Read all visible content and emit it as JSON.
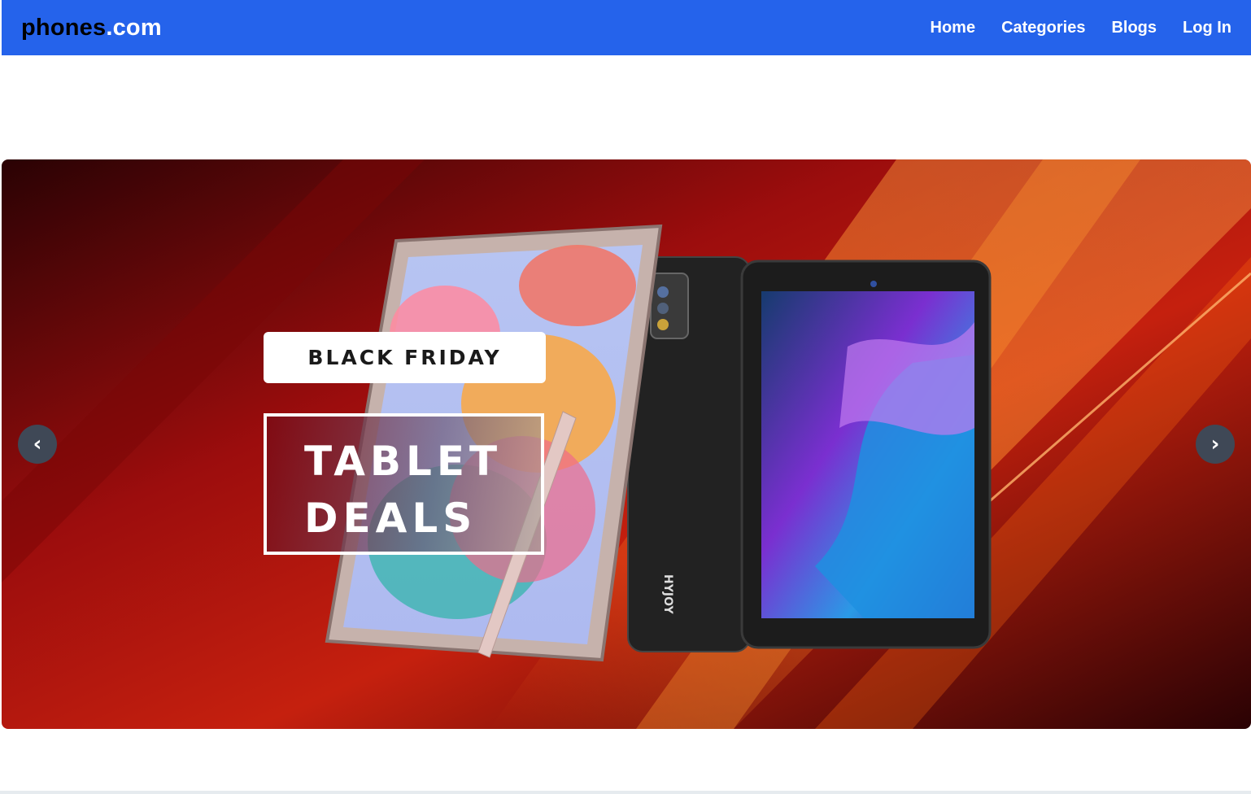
{
  "brand": {
    "name": "phones",
    "suffix": ".com"
  },
  "nav": {
    "links": [
      {
        "label": "Home"
      },
      {
        "label": "Categories"
      },
      {
        "label": "Blogs"
      },
      {
        "label": "Log In"
      }
    ]
  },
  "carousel": {
    "slide": {
      "badge_text": "BLACK FRIDAY",
      "headline_line1": "TABLET",
      "headline_line2": "DEALS",
      "tablet_brand": "HYJOY"
    },
    "prev_label": "‹",
    "next_label": "›"
  },
  "colors": {
    "navbar_bg": "#2563eb",
    "carousel_button_bg": "#3f4856",
    "slide_background": "#8b0d0d"
  }
}
